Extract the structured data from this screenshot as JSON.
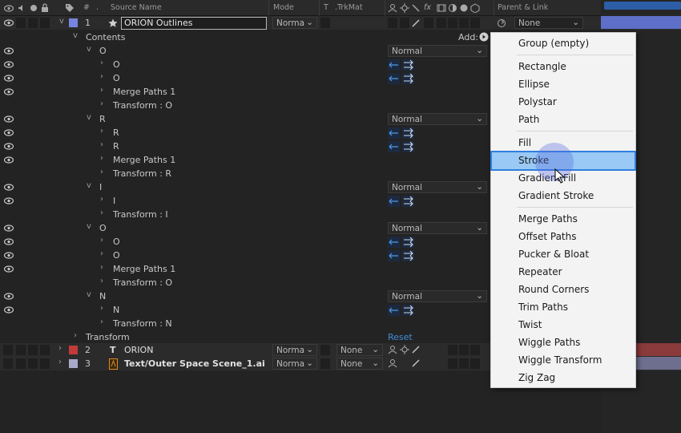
{
  "header": {
    "source_name": "Source Name",
    "number_sign": "#",
    "mode": "Mode",
    "t": "T",
    "trkmat": ".TrkMat",
    "parent_link": "Parent & Link",
    "fx": "fx"
  },
  "layer1": {
    "number": "1",
    "name": "ORION Outlines",
    "mode": "Norma",
    "parent": "None",
    "color": "#7684e0"
  },
  "contents": {
    "label": "Contents",
    "add_label": "Add:"
  },
  "groups": [
    {
      "name": "O",
      "mode": "Normal",
      "children": [
        "O",
        "O",
        "Merge Paths 1",
        "Transform : O"
      ]
    },
    {
      "name": "R",
      "mode": "Normal",
      "children": [
        "R",
        "R",
        "Merge Paths 1",
        "Transform : R"
      ]
    },
    {
      "name": "I",
      "mode": "Normal",
      "children": [
        "I",
        "Transform : I"
      ]
    },
    {
      "name": "O",
      "mode": "Normal",
      "children": [
        "O",
        "O",
        "Merge Paths 1",
        "Transform : O"
      ]
    },
    {
      "name": "N",
      "mode": "Normal",
      "children": [
        "N",
        "Transform : N"
      ]
    }
  ],
  "transform": {
    "label": "Transform",
    "reset": "Reset"
  },
  "layer2": {
    "number": "2",
    "type_icon": "T",
    "name": "ORION",
    "mode": "Norma",
    "trkmat": "None",
    "color": "#c23a3a"
  },
  "layer3": {
    "number": "3",
    "name": "Text/Outer Space Scene_1.ai",
    "mode": "Norma",
    "trkmat": "None",
    "color": "#a9a9c9"
  },
  "menu": {
    "items": [
      "Group (empty)",
      "Rectangle",
      "Ellipse",
      "Polystar",
      "Path",
      "Fill",
      "Stroke",
      "Gradient Fill",
      "Gradient Stroke",
      "Merge Paths",
      "Offset Paths",
      "Pucker & Bloat",
      "Repeater",
      "Round Corners",
      "Trim Paths",
      "Twist",
      "Wiggle Paths",
      "Wiggle Transform",
      "Zig Zag"
    ],
    "highlighted": "Stroke"
  },
  "colors": {
    "accent": "#2f7fe0",
    "highlight": "#99c9f4",
    "link": "#3f8fd6"
  }
}
